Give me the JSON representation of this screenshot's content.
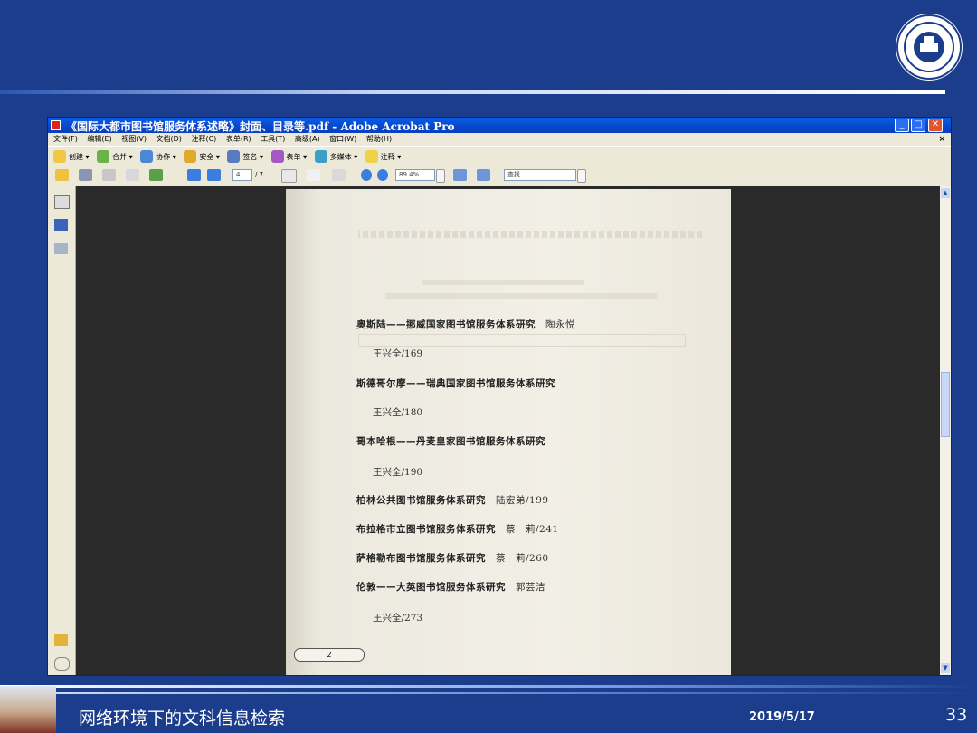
{
  "window": {
    "title": "《国际大都市图书馆服务体系述略》封面、目录等.pdf - Adobe Acrobat Pro",
    "controls": [
      "_",
      "□",
      "✕"
    ]
  },
  "menu": [
    "文件(F)",
    "编辑(E)",
    "视图(V)",
    "文档(D)",
    "注释(C)",
    "表单(R)",
    "工具(T)",
    "高级(A)",
    "窗口(W)",
    "帮助(H)"
  ],
  "menu_close": "×",
  "toolbar1": [
    "创建 ▾",
    "合并 ▾",
    "协作 ▾",
    "安全 ▾",
    "签名 ▾",
    "表单 ▾",
    "多媒体 ▾",
    "注释 ▾"
  ],
  "toolbar2": {
    "page_current": "4",
    "page_total": "/ 7",
    "zoom": "89.4%",
    "find_placeholder": "查找"
  },
  "document": {
    "toc": [
      {
        "title": "奥斯陆——挪威国家图书馆服务体系研究",
        "author": "陶永悦",
        "page": "王兴全/169"
      },
      {
        "title": "斯德哥尔摩——瑞典国家图书馆服务体系研究",
        "author": "",
        "page": "王兴全/180"
      },
      {
        "title": "哥本哈根——丹麦皇家图书馆服务体系研究",
        "author": "",
        "page": "王兴全/190"
      },
      {
        "title": "柏林公共图书馆服务体系研究",
        "author": "陆宏弟/199",
        "page": ""
      },
      {
        "title": "布拉格市立图书馆服务体系研究",
        "author": "蔡　莉/241",
        "page": ""
      },
      {
        "title": "萨格勒布图书馆服务体系研究",
        "author": "蔡　莉/260",
        "page": ""
      },
      {
        "title": "伦敦——大英图书馆服务体系研究",
        "author": "郭芸洁",
        "page": "王兴全/273"
      }
    ],
    "page_indicator": "2"
  },
  "footer": {
    "title": "网络环境下的文科信息检索",
    "date": "2019/5/17",
    "slide_number": "33"
  }
}
